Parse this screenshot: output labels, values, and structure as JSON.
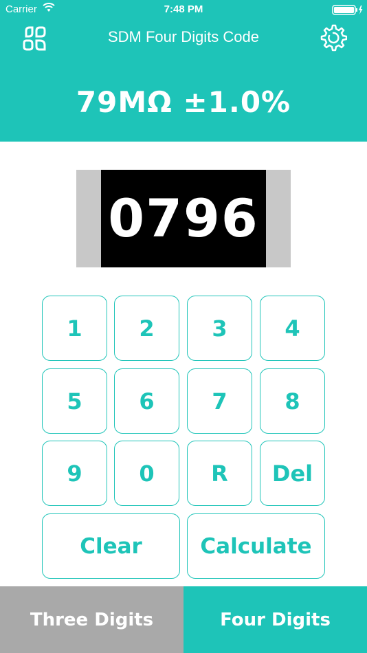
{
  "status_bar": {
    "carrier": "Carrier",
    "time": "7:48 PM"
  },
  "nav": {
    "title": "SDM Four Digits Code",
    "left_icon": "app-grid-icon",
    "right_icon": "settings-gear-icon"
  },
  "result": {
    "text": "79MΩ ±1.0%"
  },
  "resistor": {
    "code": "0796"
  },
  "keypad": {
    "row1": [
      "1",
      "2",
      "3",
      "4"
    ],
    "row2": [
      "5",
      "6",
      "7",
      "8"
    ],
    "row3": [
      "9",
      "0",
      "R",
      "Del"
    ],
    "row4": [
      "Clear",
      "Calculate"
    ]
  },
  "tabs": {
    "three_digits": "Three Digits",
    "four_digits": "Four Digits",
    "selected": "Four Digits"
  },
  "colors": {
    "accent": "#1ec4b8",
    "tab_inactive": "#a9a9a9",
    "resistor_body": "#000000",
    "resistor_cap": "#c8c8c8"
  }
}
